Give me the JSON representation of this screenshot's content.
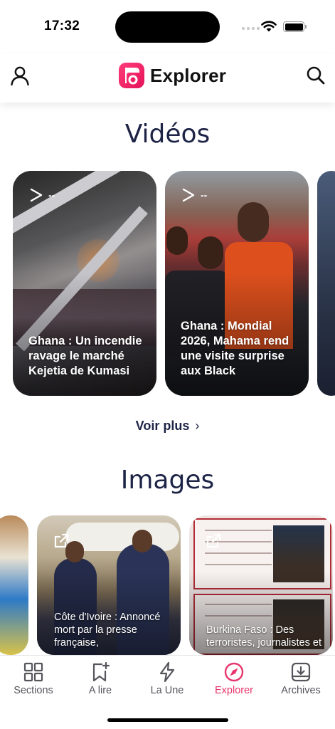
{
  "status_bar": {
    "time": "17:32"
  },
  "header": {
    "title": "Explorer"
  },
  "videos": {
    "title": "Vidéos",
    "duration_placeholder": "--",
    "items": [
      {
        "caption": "Ghana : Un incendie ravage le marché Kejetia de Kumasi"
      },
      {
        "caption": "Ghana : Mondial 2026, Mahama rend une visite surprise aux Black"
      }
    ],
    "see_more": "Voir plus"
  },
  "images": {
    "title": "Images",
    "items": [
      {
        "caption": ""
      },
      {
        "caption": "Côte d'Ivoire : Annoncé mort par la presse française,"
      },
      {
        "caption": "Burkina Faso : Des terroristes, journalistes et"
      }
    ]
  },
  "tab_bar": {
    "items": [
      {
        "label": "Sections",
        "icon": "grid-icon"
      },
      {
        "label": "A lire",
        "icon": "bookmark-plus-icon"
      },
      {
        "label": "La Une",
        "icon": "lightning-icon"
      },
      {
        "label": "Explorer",
        "icon": "compass-icon"
      },
      {
        "label": "Archives",
        "icon": "download-tray-icon"
      }
    ],
    "active": "Explorer"
  },
  "colors": {
    "accent": "#e8356d",
    "heading": "#1e2446",
    "tab_inactive": "#55565c"
  }
}
